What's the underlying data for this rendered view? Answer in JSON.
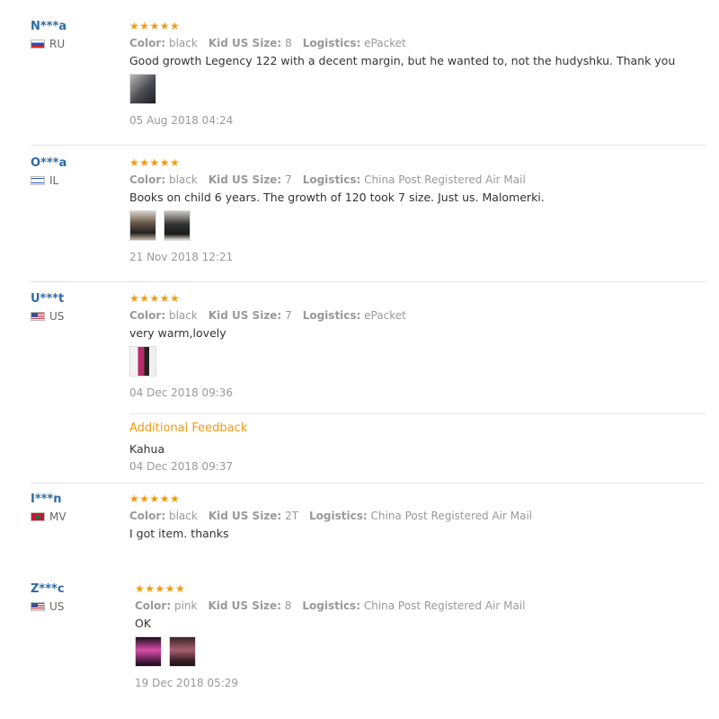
{
  "reviews": [
    {
      "user": "N***a",
      "country": "RU",
      "stars": "★★★★★",
      "color_label": "Color:",
      "color": "black",
      "size_label": "Kid US Size:",
      "size": "8",
      "logistics_label": "Logistics:",
      "logistics": "ePacket",
      "text": "Good growth Legency 122 with a decent margin, but he wanted to, not the hudyshku. Thank you",
      "date": "05 Aug 2018 04:24"
    },
    {
      "user": "O***a",
      "country": "IL",
      "stars": "★★★★★",
      "color_label": "Color:",
      "color": "black",
      "size_label": "Kid US Size:",
      "size": "7",
      "logistics_label": "Logistics:",
      "logistics": "China Post Registered Air Mail",
      "text": "Books on child 6 years. The growth of 120 took 7 size. Just us. Malomerki.",
      "date": "21 Nov 2018 12:21"
    },
    {
      "user": "U***t",
      "country": "US",
      "stars": "★★★★★",
      "color_label": "Color:",
      "color": "black",
      "size_label": "Kid US Size:",
      "size": "7",
      "logistics_label": "Logistics:",
      "logistics": "ePacket",
      "text": "very warm,lovely",
      "date": "04 Dec 2018 09:36",
      "additional": {
        "title": "Additional Feedback",
        "text": "Kahua",
        "date": "04 Dec 2018 09:37"
      }
    },
    {
      "user": "I***n",
      "country": "MV",
      "stars": "★★★★★",
      "color_label": "Color:",
      "color": "black",
      "size_label": "Kid US Size:",
      "size": "2T",
      "logistics_label": "Logistics:",
      "logistics": "China Post Registered Air Mail",
      "text": "I got item. thanks"
    },
    {
      "user": "Z***c",
      "country": "US",
      "stars": "★★★★★",
      "color_label": "Color:",
      "color": "pink",
      "size_label": "Kid US Size:",
      "size": "8",
      "logistics_label": "Logistics:",
      "logistics": "China Post Registered Air Mail",
      "text": "OK",
      "date": "19 Dec 2018 05:29"
    }
  ],
  "icons": {
    "star": "star-icon",
    "flag": "country-flag-icon",
    "photo": "review-photo"
  },
  "colors": {
    "username": "#2d6aa6",
    "stars": "#f29a13",
    "meta": "#999999",
    "text": "#333333",
    "divider": "#e3e3e3"
  }
}
